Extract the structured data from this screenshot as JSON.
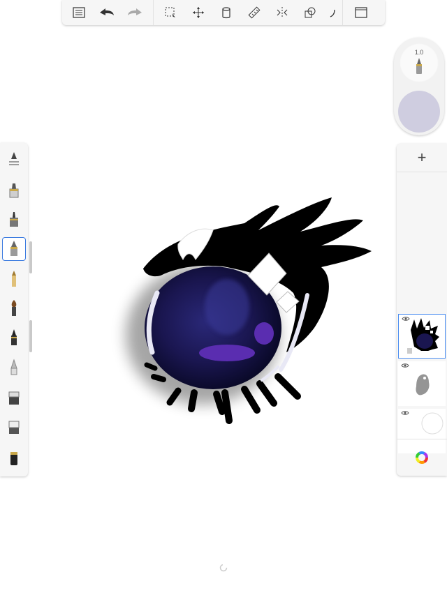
{
  "app": {
    "toolbar": {
      "tools": [
        {
          "icon": "list-icon"
        },
        {
          "icon": "undo-icon"
        },
        {
          "icon": "redo-icon"
        },
        {
          "icon": "selection-icon"
        },
        {
          "icon": "transform-icon"
        },
        {
          "icon": "bucket-fill-icon"
        },
        {
          "icon": "ruler-icon"
        },
        {
          "icon": "symmetry-icon"
        },
        {
          "icon": "shapes-icon"
        },
        {
          "icon": "curve-icon"
        },
        {
          "icon": "fullscreen-icon"
        }
      ]
    },
    "brush_puck": {
      "size_label": "1.0",
      "color": "#cfcde0"
    },
    "brush_palette": {
      "selected_index": 3,
      "brushes": [
        {
          "icon": "brush-settings-icon"
        },
        {
          "icon": "pencil-icon"
        },
        {
          "icon": "technical-pen-icon"
        },
        {
          "icon": "ballpoint-pen-icon"
        },
        {
          "icon": "fountain-pen-icon"
        },
        {
          "icon": "paintbrush-icon"
        },
        {
          "icon": "marker-icon"
        },
        {
          "icon": "airbrush-icon"
        },
        {
          "icon": "eraser-icon"
        },
        {
          "icon": "soft-eraser-icon"
        },
        {
          "icon": "smudge-icon"
        }
      ]
    },
    "layers": {
      "add_label": "+",
      "items": [
        {
          "name": "eye-drawing",
          "visible": true,
          "active": true
        },
        {
          "name": "grey-sketch",
          "visible": true,
          "active": false
        },
        {
          "name": "background",
          "visible": true,
          "active": false
        }
      ]
    }
  }
}
